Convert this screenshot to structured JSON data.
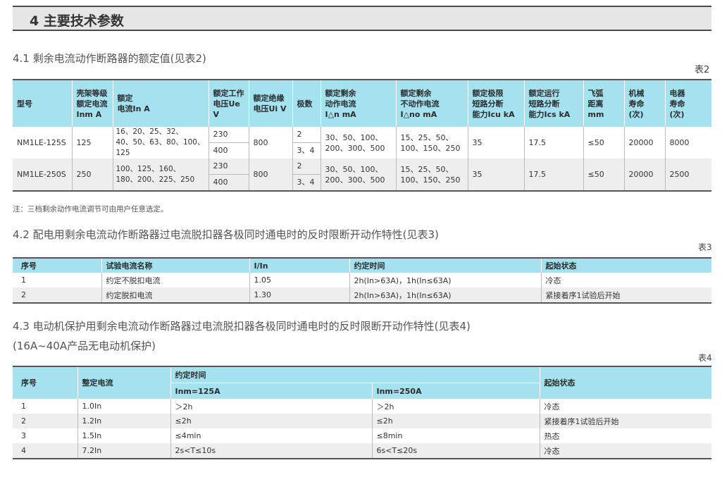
{
  "section_title": "4 主要技术参数",
  "s41": {
    "heading": "4.1 剩余电流动作断路器的额定值(见表2)",
    "table_label": "表2",
    "headers": [
      "型号",
      "壳架等级\n额定电流\nInm A",
      "额定\n电流In A",
      "额定工作\n电压Ue V",
      "额定绝缘\n电压Ui V",
      "极数",
      "额定剩余\n动作电流\nI△n mA",
      "额定剩余\n不动作电流\nI△no mA",
      "额定极限\n短路分断\n能力Icu kA",
      "额定运行\n短路分断\n能力Ics kA",
      "飞弧\n距离\nmm",
      "机械\n寿命\n(次)",
      "电器\n寿命\n(次)"
    ],
    "rows": [
      {
        "model": "NM1LE-125S",
        "inm": "125",
        "in": "16、20、25、32、\n40、50、63、80、100、125",
        "ue": [
          "230",
          "400"
        ],
        "ui": "800",
        "poles": [
          "2",
          "3、4"
        ],
        "idn": "30、50、100、\n200、300、500",
        "idno": "15、25、50、\n100、150、250",
        "icu": "35",
        "ics": "17.5",
        "arc": "≤50",
        "mech": "20000",
        "elec": "8000"
      },
      {
        "model": "NM1LE-250S",
        "inm": "250",
        "in": "100、125、160、\n180、200、225、250",
        "ue": [
          "230",
          "400"
        ],
        "ui": "800",
        "poles": [
          "2",
          "3、4"
        ],
        "idn": "30、50、100、\n200、300、500",
        "idno": "15、25、50、\n100、150、250",
        "icu": "35",
        "ics": "17.5",
        "arc": "≤50",
        "mech": "20000",
        "elec": "2500"
      }
    ],
    "note": "注：三档剩余动作电流调节可由用户任意选定。"
  },
  "s42": {
    "heading": "4.2 配电用剩余电流动作断路器过电流脱扣器各极同时通电时的反时限断开动作特性(见表3)",
    "table_label": "表3",
    "headers": [
      "序号",
      "试验电流名称",
      "I/In",
      "约定时间",
      "起始状态"
    ],
    "rows": [
      [
        "1",
        "约定不脱扣电流",
        "1.05",
        "2h(In>63A)，1h(In≤63A)",
        "冷态"
      ],
      [
        "2",
        "约定脱扣电流",
        "1.30",
        "2h(In>63A)，1h(In≤63A)",
        "紧接着序1试验后开始"
      ]
    ]
  },
  "s43": {
    "heading": "4.3 电动机保护用剩余电流动作断路器过电流脱扣器各极同时通电时的反时限断开动作特性(见表4)",
    "heading2": "(16A~40A产品无电动机保护)",
    "table_label": "表4",
    "headers": {
      "no": "序号",
      "setting": "整定电流",
      "time": "约定时间",
      "inm125": "Inm=125A",
      "inm250": "Inm=250A",
      "state": "起始状态"
    },
    "rows": [
      [
        "1",
        "1.0In",
        "＞2h",
        "＞2h",
        "冷态"
      ],
      [
        "2",
        "1.2In",
        "≤2h",
        "≤2h",
        "紧接着序1试验后开始"
      ],
      [
        "3",
        "1.5In",
        "≤4min",
        "≤8min",
        "热态"
      ],
      [
        "4",
        "7.2In",
        "2s<T≤10s",
        "6s<T≤20s",
        "冷态"
      ]
    ]
  },
  "colors": {
    "header_bg": "#a3e2ee",
    "alt_row": "#eeeeee",
    "banner_bg": "#e6e6e6"
  }
}
